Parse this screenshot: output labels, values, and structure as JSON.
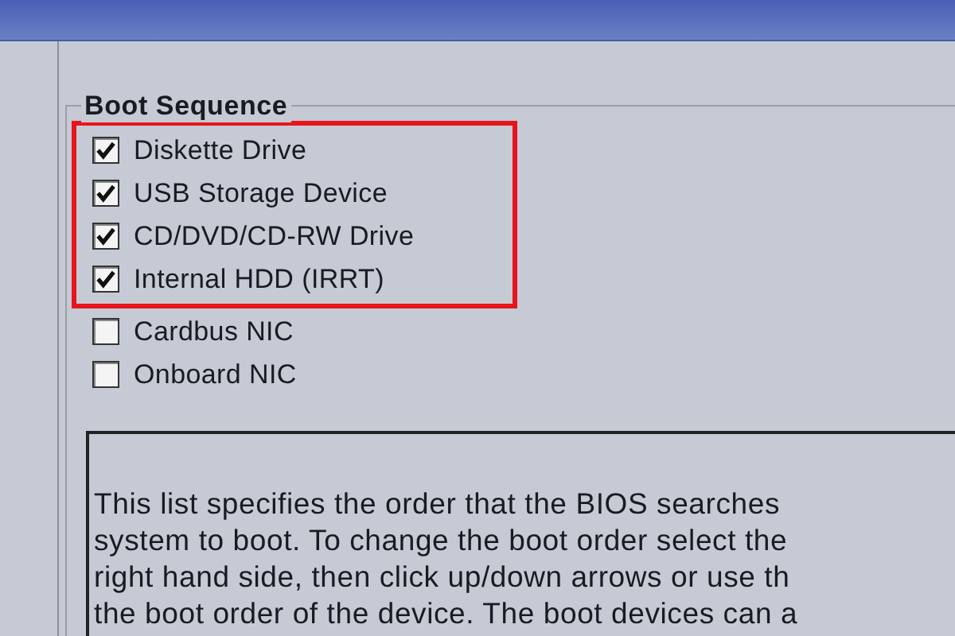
{
  "group_title": "Boot Sequence",
  "devices": [
    {
      "label": "Diskette Drive",
      "checked": true,
      "highlighted": true
    },
    {
      "label": "USB Storage Device",
      "checked": true,
      "highlighted": true
    },
    {
      "label": "CD/DVD/CD-RW Drive",
      "checked": true,
      "highlighted": true
    },
    {
      "label": "Internal HDD (IRRT)",
      "checked": true,
      "highlighted": true
    },
    {
      "label": "Cardbus NIC",
      "checked": false,
      "highlighted": false
    },
    {
      "label": "Onboard NIC",
      "checked": false,
      "highlighted": false
    }
  ],
  "description_lines": [
    "This list specifies the order that the BIOS searches",
    "system to boot. To change the boot order select the",
    "right hand side, then click up/down arrows or use th",
    "the boot order of the device. The boot devices can a"
  ]
}
